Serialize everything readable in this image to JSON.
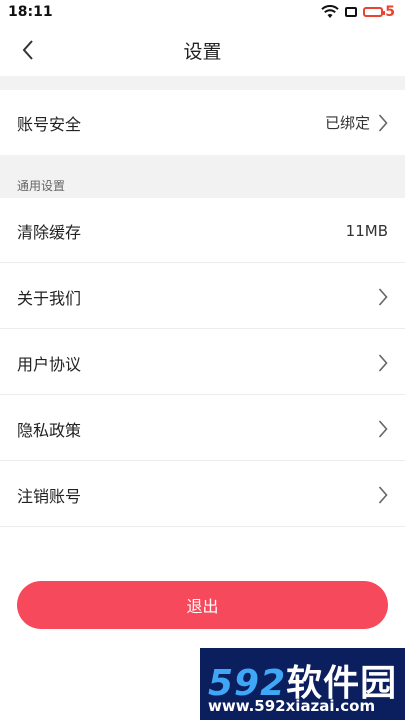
{
  "status": {
    "time": "18:11",
    "battery": "5",
    "battery_color": "#e8442f"
  },
  "nav": {
    "title": "设置",
    "back_icon": "chevron-left-icon"
  },
  "account": {
    "label": "账号安全",
    "value": "已绑定"
  },
  "section": {
    "label": "通用设置"
  },
  "items": [
    {
      "label": "清除缓存",
      "value": "11MB"
    },
    {
      "label": "关于我们"
    },
    {
      "label": "用户协议"
    },
    {
      "label": "隐私政策"
    },
    {
      "label": "注销账号"
    }
  ],
  "logout": {
    "label": "退出",
    "color": "#f64a5c"
  },
  "watermark": {
    "number": "592",
    "text": "软件园",
    "url": "www.592xiazai.com"
  }
}
